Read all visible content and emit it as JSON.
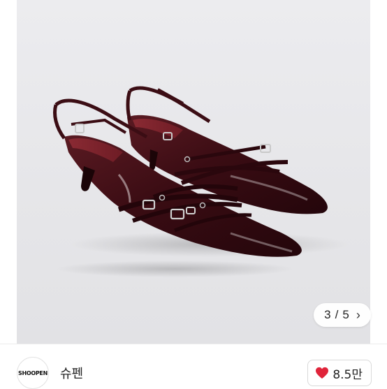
{
  "gallery": {
    "current_page": "3",
    "separator": "/",
    "total_pages": "5",
    "next_icon": "chevron-right-icon",
    "image_subject": "dark burgundy patent slingback kitten-heel pumps with buckle straps"
  },
  "seller": {
    "avatar_text": "SHOOPEN",
    "name": "슈펜"
  },
  "like": {
    "icon": "heart-icon",
    "icon_color": "#e0243a",
    "count": "8.5만"
  }
}
